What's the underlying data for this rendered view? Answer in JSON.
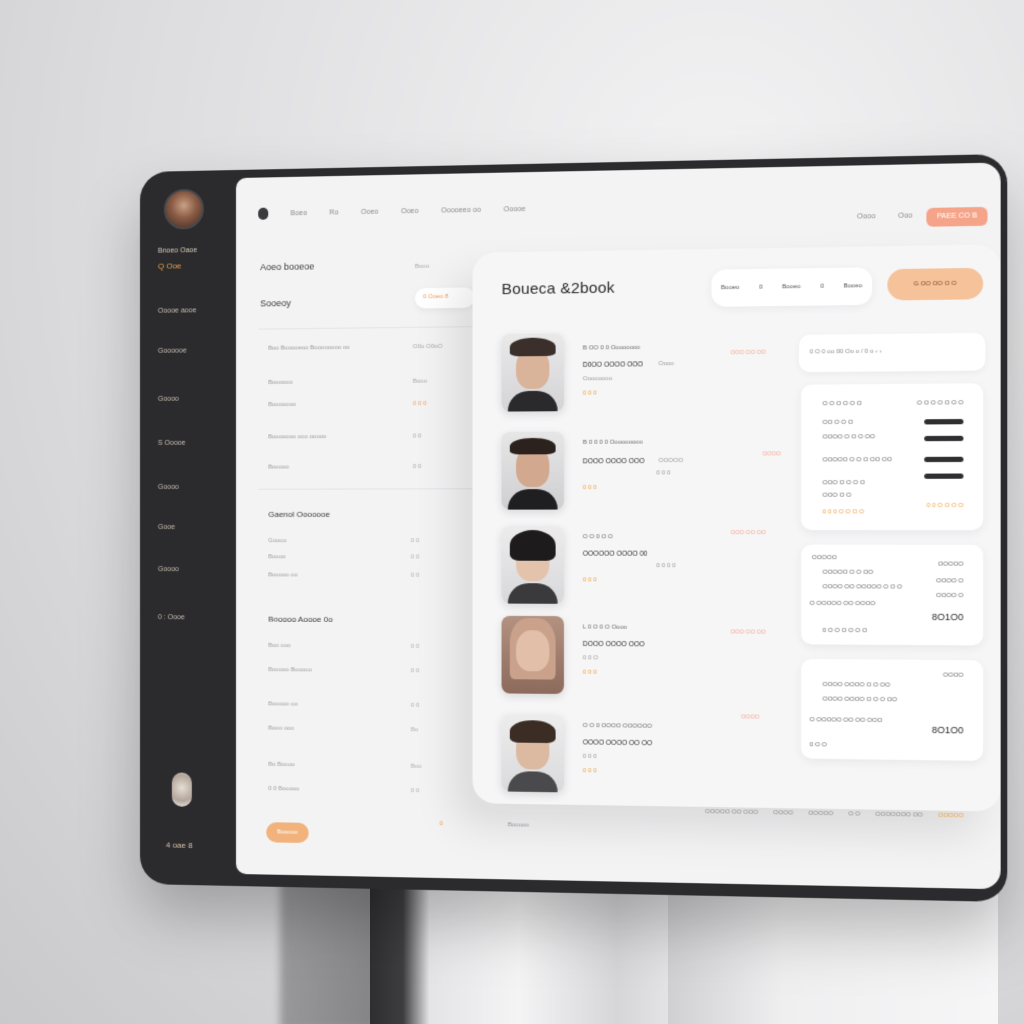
{
  "sidebar": {
    "user_name": "Bnoeo  Oaoe",
    "user_sub": "Q  Ooe",
    "items": [
      "Ooooe aooe",
      "Goooooe",
      "Goooo",
      "S  Ooooe",
      "Goooo",
      "Gooe",
      "Goooo",
      "0  :  Oooe"
    ],
    "footer": "4   oae  8"
  },
  "topnav": {
    "links": [
      "Boeo",
      "Ro",
      "Ooeo",
      "Ooeo",
      "Ooooeeo oo",
      "Ooooe"
    ],
    "right_link": "Oooo",
    "right_link2": "Ooo",
    "cta": "PAEE CO  B"
  },
  "background_panel": {
    "title": "Aoeo booeoe",
    "subtitle": "Sooeoy",
    "chip": "Booo",
    "pill": "0  Ooeo  8",
    "table_rows": [
      {
        "l": "Boo Booooeoo          Boooooooo oo",
        "r": "O0o   O0oO"
      },
      {
        "l": "Boooooo",
        "r": "Booo"
      },
      {
        "l": "Booooooo",
        "r": "0 0 0"
      },
      {
        "l": "Booooooo  ooo    ooooo",
        "r": "0 0"
      },
      {
        "l": "Booooo",
        "r": "0 0"
      }
    ],
    "section1": "Gaenol    Ooooooe",
    "section1_rows": [
      {
        "l": "Goooo",
        "r": "0 0"
      },
      {
        "l": "Boooo",
        "r": "0 0"
      },
      {
        "l": "Booooo    oo",
        "r": "0 0"
      }
    ],
    "section2": "Booooo     Aoooe  0o",
    "section2_rows": [
      {
        "l": "Boo       ooo",
        "r": "0 0"
      },
      {
        "l": "Booooo     Booooo",
        "r": "0 0"
      },
      {
        "l": "Booooo oo",
        "r": "0 0"
      },
      {
        "l": "Booo     ooo",
        "r": "Bo"
      },
      {
        "l": "Bo         Boooo",
        "r": "Boo"
      },
      {
        "l": "0 0          Booooo",
        "r": "0 0"
      }
    ],
    "button": "Booooo",
    "foot_mark": "0",
    "foot_text": "Booooo"
  },
  "card": {
    "title": "Boueca &2book",
    "segments": [
      "Booeo",
      "0",
      "Booeo",
      "0",
      "Booeo"
    ],
    "cta": "G  OO   OO O  O",
    "people": [
      {
        "meta": "B OO   0 0 Oooooooo",
        "name": "D0OO OOOO   OOO",
        "tag": "Oooo",
        "sub": "Oooooooo",
        "rate": "0  0  0",
        "right": "OOO  OO  OO"
      },
      {
        "meta": "B 0  0 0 0  Ooooooooo",
        "name": "DOOO OOOO   OOO",
        "tag": "OOOOO",
        "sub": "0 0 0",
        "rate": "0  0  0",
        "right": "OOOO"
      },
      {
        "meta": "O O 0 O O",
        "name": "OOOOOO  OOOO  00",
        "tag": "",
        "sub": "0 0 0 0",
        "rate": "0  0  0",
        "right": "OOO  OO  OO"
      },
      {
        "meta": "L 0 O  0 O Oooo",
        "name": "DOOO OOOO   OOO",
        "tag": "",
        "sub": "0  0  O",
        "rate": "0  0  0",
        "right": "OOO  OO  OO"
      },
      {
        "meta": "O O 0 OOOO OOOOOO",
        "name": "OOOO OOOO  OO  OO",
        "tag": "",
        "sub": "0  0  0",
        "rate": "0  0  0",
        "right": "OOOO"
      }
    ],
    "filter_text": "0   O 0 oo  00  Oo o  /   0 o  ‹  ›",
    "widget1": {
      "header_l": "O O O  O O O",
      "header_r": "O O O  O O O O",
      "rows": [
        "OO O O O",
        "OOOO O O O OO",
        "OOOOO O O O OO OO",
        "OOO O O O O"
      ],
      "extra": "OOO O O",
      "foot": "0  0 0   O O O O",
      "foot_r": "0 0  O O O O"
    },
    "widget2": {
      "header_l": "OOOOO",
      "header_r": "OOOOO",
      "rows": [
        "OOOOO O O OO",
        "OOOO OO OOOOO  O O O",
        "O  OOOOO OO OOOO"
      ],
      "right_rows": [
        "OOOO O",
        "OOOO O",
        ""
      ],
      "total": "8O1O0",
      "foot": "0  O O  O O O O"
    },
    "widget3": {
      "header_r": "OOOO",
      "rows": [
        "OOOO OOOO O O OO",
        "OOOO OOOO O O O OO",
        "O  OOOOO OO OO OOO"
      ],
      "total": "8O1O0",
      "foot": "0  O O"
    },
    "bottom_links": [
      "OOOOO OO OOO",
      "OOOO",
      "OOOOO",
      "O O",
      "OOOOOOO OO",
      "OOOOO"
    ]
  },
  "colors": {
    "sidebar_bg": "#2b2b2e",
    "accent_orange": "#f0a040",
    "accent_peach": "#f5a48a",
    "card_bg": "#f6f6f7"
  }
}
